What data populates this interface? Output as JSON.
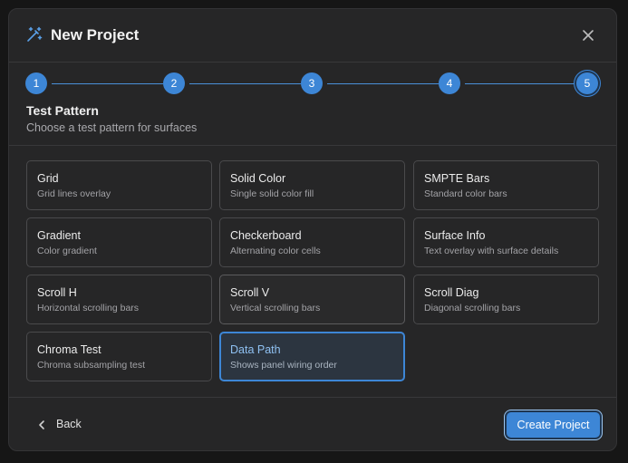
{
  "dialog": {
    "title": "New Project",
    "icon": "magic-wand-icon",
    "close_icon": "close-icon"
  },
  "stepper": {
    "steps": [
      "1",
      "2",
      "3",
      "4",
      "5"
    ],
    "current_step": 5
  },
  "section": {
    "title": "Test Pattern",
    "subtitle": "Choose a test pattern for surfaces"
  },
  "patterns": [
    {
      "name": "Grid",
      "desc": "Grid lines overlay"
    },
    {
      "name": "Solid Color",
      "desc": "Single solid color fill"
    },
    {
      "name": "SMPTE Bars",
      "desc": "Standard color bars"
    },
    {
      "name": "Gradient",
      "desc": "Color gradient"
    },
    {
      "name": "Checkerboard",
      "desc": "Alternating color cells"
    },
    {
      "name": "Surface Info",
      "desc": "Text overlay with surface details"
    },
    {
      "name": "Scroll H",
      "desc": "Horizontal scrolling bars"
    },
    {
      "name": "Scroll V",
      "desc": "Vertical scrolling bars"
    },
    {
      "name": "Scroll Diag",
      "desc": "Diagonal scrolling bars"
    },
    {
      "name": "Chroma Test",
      "desc": "Chroma subsampling test"
    },
    {
      "name": "Data Path",
      "desc": "Shows panel wiring order"
    }
  ],
  "selected_pattern": "Data Path",
  "footer": {
    "back_label": "Back",
    "create_label": "Create Project"
  },
  "colors": {
    "accent": "#3d86d6",
    "dialog_bg": "#262627",
    "selected_text": "#8fc1f2"
  }
}
